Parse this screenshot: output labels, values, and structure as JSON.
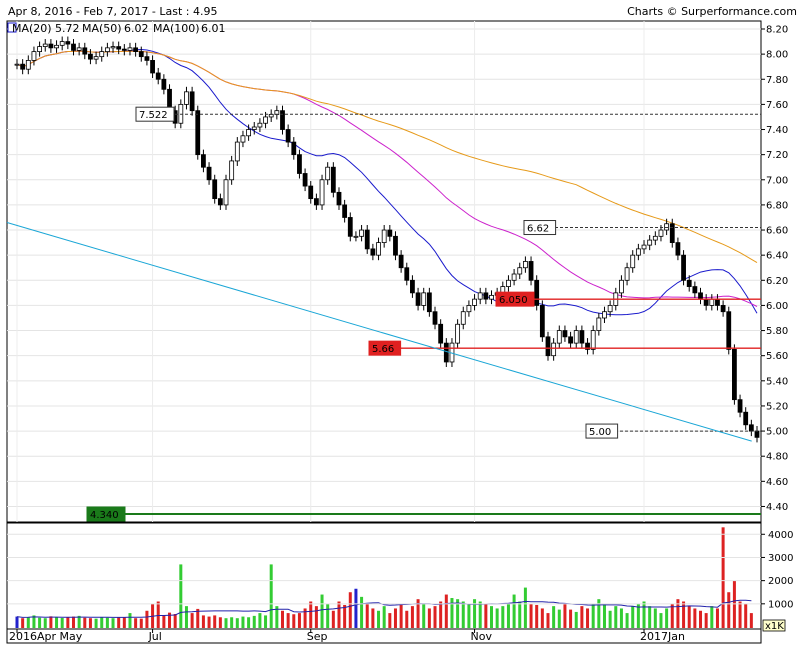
{
  "header": {
    "range_text": "Apr 8, 2016 - Feb 7, 2017 - Last : 4.95",
    "credit": "Charts © Surperformance.com"
  },
  "legend": [
    {
      "label": "MA(20)",
      "value": "5.72",
      "color": "#1a1acc"
    },
    {
      "label": "MA(50)",
      "value": "6.02",
      "color": "#cc22cc"
    },
    {
      "label": "MA(100)",
      "value": "6.01",
      "color": "#e69a1a"
    }
  ],
  "chart_data": [
    {
      "type": "candlestick",
      "title": "",
      "ylim": [
        4.3,
        8.3
      ],
      "y_ticks": [
        4.4,
        4.6,
        4.8,
        5.0,
        5.2,
        5.4,
        5.6,
        5.8,
        6.0,
        6.2,
        6.4,
        6.6,
        6.8,
        7.0,
        7.2,
        7.4,
        7.6,
        7.8,
        8.0,
        8.2
      ],
      "x_labels": [
        "2016Apr May",
        "Jul",
        "Sep",
        "Nov",
        "2017Jan"
      ],
      "grid": true,
      "close": [
        7.92,
        7.88,
        7.95,
        8.02,
        8.06,
        8.08,
        8.05,
        8.07,
        8.1,
        8.08,
        8.03,
        8.05,
        8.0,
        7.96,
        7.98,
        8.02,
        8.05,
        8.06,
        8.04,
        8.03,
        8.05,
        8.02,
        7.98,
        7.95,
        7.85,
        7.8,
        7.72,
        7.55,
        7.45,
        7.6,
        7.7,
        7.55,
        7.2,
        7.1,
        7.0,
        6.85,
        6.8,
        7.0,
        7.15,
        7.3,
        7.35,
        7.4,
        7.42,
        7.45,
        7.5,
        7.52,
        7.55,
        7.4,
        7.3,
        7.2,
        7.05,
        6.95,
        6.85,
        6.8,
        7.0,
        7.1,
        6.9,
        6.8,
        6.7,
        6.55,
        6.55,
        6.6,
        6.45,
        6.4,
        6.5,
        6.6,
        6.55,
        6.4,
        6.3,
        6.2,
        6.1,
        6.0,
        6.1,
        5.95,
        5.85,
        5.7,
        5.55,
        5.7,
        5.85,
        5.95,
        6.0,
        6.05,
        6.1,
        6.05,
        6.08,
        6.1,
        6.15,
        6.2,
        6.25,
        6.3,
        6.35,
        6.2,
        6.0,
        5.75,
        5.6,
        5.7,
        5.8,
        5.75,
        5.7,
        5.8,
        5.7,
        5.65,
        5.8,
        5.9,
        5.95,
        6.0,
        6.1,
        6.2,
        6.3,
        6.4,
        6.45,
        6.48,
        6.52,
        6.55,
        6.6,
        6.65,
        6.5,
        6.4,
        6.2,
        6.15,
        6.1,
        6.05,
        6.0,
        6.05,
        6.0,
        5.95,
        5.65,
        5.25,
        5.15,
        5.05,
        5.0,
        4.95
      ],
      "volume_ylim": [
        0,
        4400
      ],
      "volume_ticks": [
        1000,
        2000,
        3000,
        4000
      ],
      "volume_unit": "x1K",
      "volume": [
        450,
        380,
        420,
        500,
        400,
        380,
        460,
        420,
        390,
        410,
        450,
        480,
        400,
        380,
        360,
        420,
        400,
        380,
        420,
        410,
        600,
        380,
        360,
        700,
        1000,
        1100,
        500,
        620,
        560,
        2700,
        900,
        600,
        780,
        500,
        450,
        500,
        420,
        380,
        420,
        380,
        450,
        420,
        480,
        600,
        500,
        2700,
        900,
        700,
        600,
        550,
        600,
        800,
        1100,
        900,
        1400,
        1000,
        700,
        1100,
        950,
        1500,
        1650,
        1300,
        1000,
        800,
        700,
        900,
        600,
        800,
        1000,
        700,
        900,
        1200,
        1000,
        800,
        900,
        1100,
        1400,
        1250,
        1200,
        1100,
        1000,
        1200,
        1100,
        1000,
        900,
        800,
        900,
        1000,
        1400,
        1100,
        1700,
        1000,
        950,
        800,
        600,
        900,
        750,
        1000,
        750,
        650,
        900,
        800,
        1000,
        1200,
        1000,
        700,
        900,
        800,
        600,
        900,
        1000,
        1100,
        900,
        800,
        600,
        800,
        1000,
        1200,
        1100,
        900,
        800,
        700,
        600,
        900,
        800,
        4300,
        1500,
        2000,
        1100,
        1000,
        600
      ],
      "reference_lines": [
        {
          "label": "7.522",
          "value": 7.522,
          "style": "dashed",
          "color": "#333333"
        },
        {
          "label": "6.62",
          "value": 6.62,
          "style": "dashed",
          "color": "#333333"
        },
        {
          "label": "6.050",
          "value": 6.05,
          "style": "solid",
          "color": "#e02020"
        },
        {
          "label": "5.66",
          "value": 5.66,
          "style": "solid",
          "color": "#e02020"
        },
        {
          "label": "5.00",
          "value": 5.0,
          "style": "dashed",
          "color": "#333333"
        },
        {
          "label": "4.340",
          "value": 4.34,
          "style": "solid",
          "color": "#1a7a1a"
        }
      ],
      "trendline": {
        "from": [
          0,
          6.66
        ],
        "to": [
          129,
          4.92
        ],
        "color": "#1aa6d6"
      }
    }
  ]
}
